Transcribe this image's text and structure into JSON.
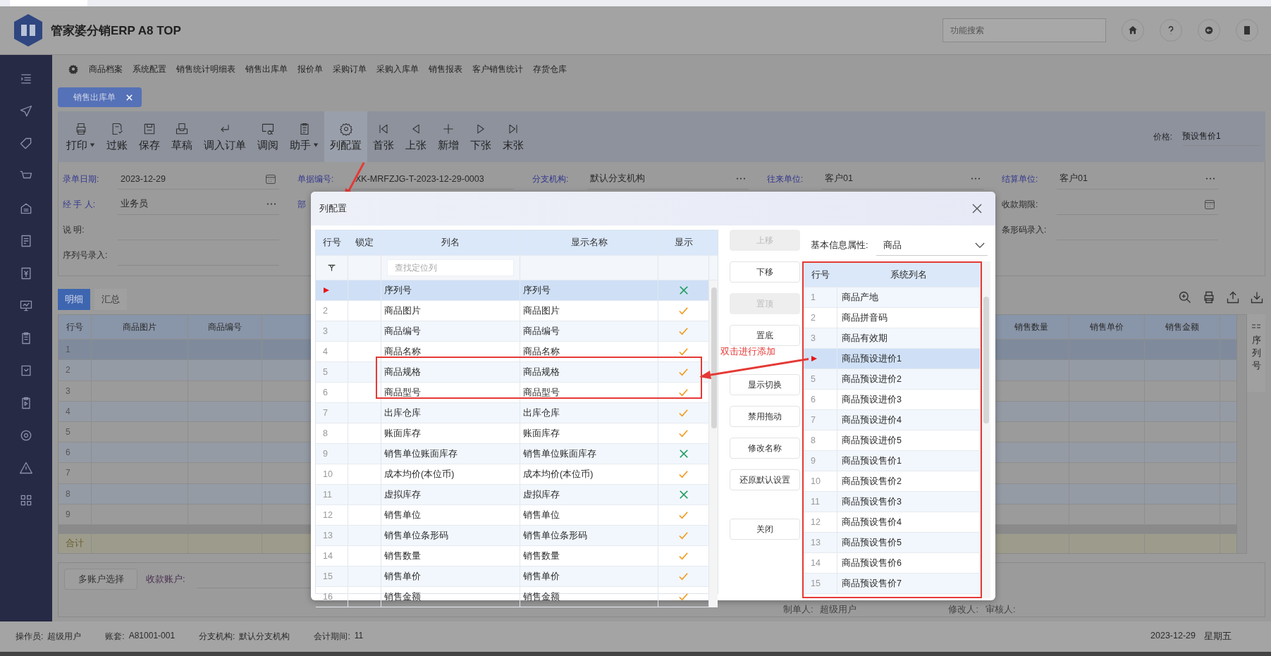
{
  "app": {
    "title": "管家婆分销ERP A8 TOP",
    "search": {
      "placeholder": "功能搜索"
    }
  },
  "menu": [
    "商品档案",
    "系统配置",
    "销售统计明细表",
    "销售出库单",
    "报价单",
    "采购订单",
    "采购入库单",
    "销售报表",
    "客户销售统计",
    "存货仓库"
  ],
  "open_tabs": [
    {
      "label": "销售出库单",
      "selected": true
    }
  ],
  "toolbar": [
    {
      "label": "打印",
      "kind": "print",
      "dropdown": true,
      "selected": false
    },
    {
      "label": "过账",
      "kind": "post",
      "dropdown": false,
      "selected": false
    },
    {
      "label": "保存",
      "kind": "save",
      "dropdown": false,
      "selected": false
    },
    {
      "label": "草稿",
      "kind": "draft",
      "dropdown": false,
      "selected": false
    },
    {
      "label": "调入订单",
      "kind": "import",
      "dropdown": false,
      "selected": false
    },
    {
      "label": "调阅",
      "kind": "view",
      "dropdown": false,
      "selected": false
    },
    {
      "label": "助手",
      "kind": "helper",
      "dropdown": true,
      "selected": false
    },
    {
      "label": "列配置",
      "kind": "config",
      "dropdown": false,
      "selected": true
    },
    {
      "label": "首张",
      "kind": "first",
      "dropdown": false,
      "selected": false
    },
    {
      "label": "上张",
      "kind": "prev",
      "dropdown": false,
      "selected": false
    },
    {
      "label": "新增",
      "kind": "add",
      "dropdown": false,
      "selected": false
    },
    {
      "label": "下张",
      "kind": "next",
      "dropdown": false,
      "selected": false
    },
    {
      "label": "末张",
      "kind": "last",
      "dropdown": false,
      "selected": false
    }
  ],
  "price": {
    "label": "价格:",
    "value": "预设售价1"
  },
  "form": {
    "rows": [
      {
        "fields": [
          {
            "label": "录单日期:",
            "value": "2023-12-29",
            "link": true,
            "kind": "date"
          },
          {
            "label": "单据编号:",
            "value": "XK-MRFZJG-T-2023-12-29-0003",
            "link": true,
            "kind": "text"
          },
          {
            "label": "分支机构:",
            "value": "默认分支机构",
            "link": true,
            "kind": "lookup"
          },
          {
            "label": "往来单位:",
            "value": "客户01",
            "link": true,
            "kind": "lookup"
          },
          {
            "label": "结算单位:",
            "value": "客户01",
            "link": true,
            "kind": "lookup"
          }
        ]
      },
      {
        "fields": [
          {
            "label": "经 手 人:",
            "value": "业务员",
            "link": true,
            "kind": "lookup"
          },
          {
            "label": "部",
            "link": true,
            "kind": "text"
          },
          {
            "label": "收款期限:",
            "link": false,
            "kind": "date"
          }
        ]
      },
      {
        "fields": [
          {
            "label": "说 明:",
            "link": false,
            "kind": "text"
          },
          {
            "label": "条形码录入:",
            "link": false,
            "kind": "text"
          }
        ]
      },
      {
        "fields": [
          {
            "label": "序列号录入:",
            "link": false,
            "kind": "text"
          }
        ]
      }
    ]
  },
  "detail": {
    "tabs": [
      {
        "label": "明细",
        "selected": true
      },
      {
        "label": "汇总",
        "selected": false
      }
    ],
    "left_columns": [
      "行号",
      "商品图片",
      "商品编号"
    ],
    "right_columns": [
      "销售数量",
      "销售单价",
      "销售金额"
    ],
    "rows": [
      {
        "no": "1",
        "selected": true
      },
      {
        "no": "2",
        "selected": false
      },
      {
        "no": "3",
        "selected": false
      },
      {
        "no": "4",
        "selected": false
      },
      {
        "no": "5",
        "selected": false
      },
      {
        "no": "6",
        "selected": false
      },
      {
        "no": "7",
        "selected": false
      },
      {
        "no": "8",
        "selected": false
      },
      {
        "no": "9",
        "selected": false
      }
    ],
    "total_label": "合计",
    "side_panel": "序列号"
  },
  "payment": {
    "button": "多账户选择",
    "account_label": "收款账户:"
  },
  "signoff": [
    {
      "label": "制单人:",
      "value": "超级用户"
    },
    {
      "label": "修改人:"
    },
    {
      "label": "审核人:"
    }
  ],
  "status_bar": {
    "items": [
      {
        "label": "操作员:",
        "value": "超级用户"
      },
      {
        "label": "账套:",
        "value": "A81001-001"
      },
      {
        "label": "分支机构:",
        "value": "默认分支机构"
      },
      {
        "label": "会计期间:",
        "value": "11"
      }
    ],
    "date": "2023-12-29",
    "weekday": "星期五"
  },
  "dialog": {
    "title": "列配置",
    "columns_header": [
      "行号",
      "锁定",
      "列名",
      "显示名称",
      "显示"
    ],
    "filter_placeholder": "查找定位列",
    "columns": [
      {
        "name": "序列号",
        "display": "序列号",
        "shown": false,
        "selected": true
      },
      {
        "no": "2",
        "name": "商品图片",
        "display": "商品图片",
        "shown": true,
        "selected": false
      },
      {
        "no": "3",
        "name": "商品编号",
        "display": "商品编号",
        "shown": true,
        "selected": false
      },
      {
        "no": "4",
        "name": "商品名称",
        "display": "商品名称",
        "shown": true,
        "selected": false
      },
      {
        "no": "5",
        "name": "商品规格",
        "display": "商品规格",
        "shown": true,
        "selected": false
      },
      {
        "no": "6",
        "name": "商品型号",
        "display": "商品型号",
        "shown": true,
        "selected": false
      },
      {
        "no": "7",
        "name": "出库仓库",
        "display": "出库仓库",
        "shown": true,
        "selected": false
      },
      {
        "no": "8",
        "name": "账面库存",
        "display": "账面库存",
        "shown": true,
        "selected": false
      },
      {
        "no": "9",
        "name": "销售单位账面库存",
        "display": "销售单位账面库存",
        "shown": false,
        "selected": false
      },
      {
        "no": "10",
        "name": "成本均价(本位币)",
        "display": "成本均价(本位币)",
        "shown": true,
        "selected": false
      },
      {
        "no": "11",
        "name": "虚拟库存",
        "display": "虚拟库存",
        "shown": false,
        "selected": false
      },
      {
        "no": "12",
        "name": "销售单位",
        "display": "销售单位",
        "shown": true,
        "selected": false
      },
      {
        "no": "13",
        "name": "销售单位条形码",
        "display": "销售单位条形码",
        "shown": true,
        "selected": false
      },
      {
        "no": "14",
        "name": "销售数量",
        "display": "销售数量",
        "shown": true,
        "selected": false
      },
      {
        "no": "15",
        "name": "销售单价",
        "display": "销售单价",
        "shown": true,
        "selected": false
      },
      {
        "no": "16",
        "name": "销售金额",
        "display": "销售金额",
        "shown": true,
        "selected": false
      }
    ],
    "button_groups": [
      [
        {
          "label": "上移",
          "disabled": true
        },
        {
          "label": "下移",
          "disabled": false
        },
        {
          "label": "置顶",
          "disabled": true
        },
        {
          "label": "置底",
          "disabled": false
        }
      ],
      [
        {
          "label": "显示切换",
          "disabled": false
        },
        {
          "label": "禁用拖动",
          "disabled": false
        },
        {
          "label": "修改名称",
          "disabled": false
        },
        {
          "label": "还原默认设置",
          "disabled": false
        }
      ],
      [
        {
          "label": "关闭",
          "disabled": false
        }
      ]
    ],
    "attribute": {
      "label": "基本信息属性:",
      "value": "商品"
    },
    "system_header": [
      "行号",
      "系统列名"
    ],
    "system_columns": [
      {
        "no": "1",
        "name": "商品产地",
        "selected": false
      },
      {
        "no": "2",
        "name": "商品拼音码",
        "selected": false
      },
      {
        "no": "3",
        "name": "商品有效期",
        "selected": false
      },
      {
        "name": "商品预设进价1",
        "selected": true
      },
      {
        "no": "5",
        "name": "商品预设进价2",
        "selected": false
      },
      {
        "no": "6",
        "name": "商品预设进价3",
        "selected": false
      },
      {
        "no": "7",
        "name": "商品预设进价4",
        "selected": false
      },
      {
        "no": "8",
        "name": "商品预设进价5",
        "selected": false
      },
      {
        "no": "9",
        "name": "商品预设售价1",
        "selected": false
      },
      {
        "no": "10",
        "name": "商品预设售价2",
        "selected": false
      },
      {
        "no": "11",
        "name": "商品预设售价3",
        "selected": false
      },
      {
        "no": "12",
        "name": "商品预设售价4",
        "selected": false
      },
      {
        "no": "13",
        "name": "商品预设售价5",
        "selected": false
      },
      {
        "no": "14",
        "name": "商品预设售价6",
        "selected": false
      },
      {
        "no": "15",
        "name": "商品预设售价7",
        "selected": false
      }
    ]
  },
  "annotation": {
    "note": "双击进行添加"
  }
}
